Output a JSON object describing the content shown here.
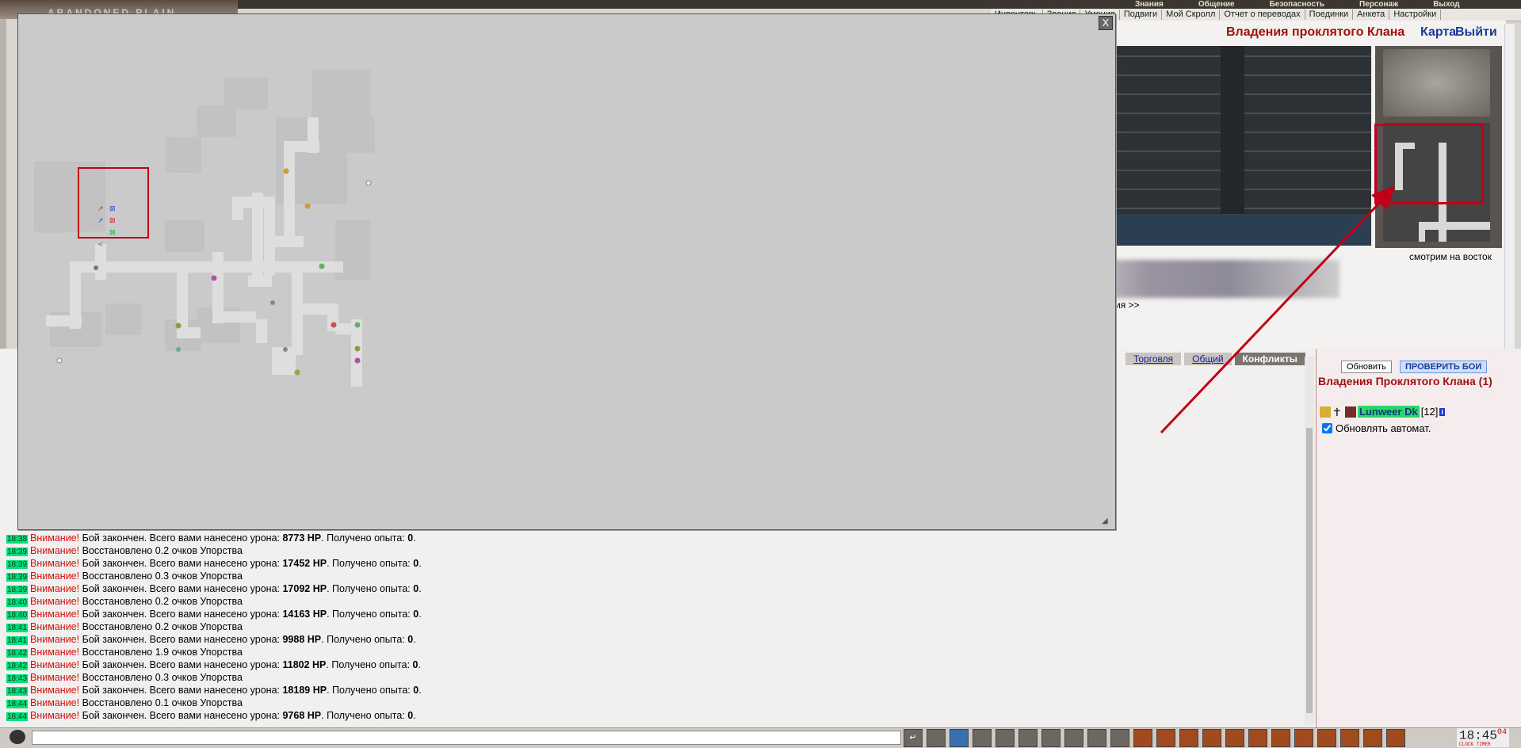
{
  "header": {
    "logo_text": "ABANDONED PLAIN",
    "top_menu": [
      "Знания",
      "Общение",
      "Безопасность",
      "Персонаж",
      "Выход"
    ],
    "sub_menu": [
      "Инвентарь",
      "Звания",
      "Умения",
      "Подвиги",
      "Мой Скролл",
      "Отчет о переводах",
      "Поединки",
      "Анкета",
      "Настройки"
    ]
  },
  "location": {
    "title": "Владения проклятого Клана",
    "map_link": "Карта",
    "exit_link": "Выйти",
    "facing": "смотрим на восток",
    "more": "ия >>"
  },
  "map_window": {
    "close_label": "X"
  },
  "chat": {
    "tabs": [
      "Торговля",
      "Общий",
      "Конфликты"
    ],
    "active_tab": "Конфликты",
    "lines": [
      {
        "time": "18:38",
        "warn": "Внимание!",
        "pre": "Бой закончен. Всего вами нанесено урона: ",
        "dmg": "8773 HP",
        "mid": ". Получено опыта: ",
        "exp": "0",
        "end": "."
      },
      {
        "time": "18:39",
        "warn": "Внимание!",
        "pre": "Восстановлено 0.2 очков Упорства",
        "dmg": "",
        "mid": "",
        "exp": "",
        "end": ""
      },
      {
        "time": "18:39",
        "warn": "Внимание!",
        "pre": "Бой закончен. Всего вами нанесено урона: ",
        "dmg": "17452 HP",
        "mid": ". Получено опыта: ",
        "exp": "0",
        "end": "."
      },
      {
        "time": "18:39",
        "warn": "Внимание!",
        "pre": "Восстановлено 0.3 очков Упорства",
        "dmg": "",
        "mid": "",
        "exp": "",
        "end": ""
      },
      {
        "time": "18:39",
        "warn": "Внимание!",
        "pre": "Бой закончен. Всего вами нанесено урона: ",
        "dmg": "17092 HP",
        "mid": ". Получено опыта: ",
        "exp": "0",
        "end": "."
      },
      {
        "time": "18:40",
        "warn": "Внимание!",
        "pre": "Восстановлено 0.2 очков Упорства",
        "dmg": "",
        "mid": "",
        "exp": "",
        "end": ""
      },
      {
        "time": "18:40",
        "warn": "Внимание!",
        "pre": "Бой закончен. Всего вами нанесено урона: ",
        "dmg": "14163 HP",
        "mid": ". Получено опыта: ",
        "exp": "0",
        "end": "."
      },
      {
        "time": "18:41",
        "warn": "Внимание!",
        "pre": "Восстановлено 0.2 очков Упорства",
        "dmg": "",
        "mid": "",
        "exp": "",
        "end": ""
      },
      {
        "time": "18:41",
        "warn": "Внимание!",
        "pre": "Бой закончен. Всего вами нанесено урона: ",
        "dmg": "9988 HP",
        "mid": ". Получено опыта: ",
        "exp": "0",
        "end": "."
      },
      {
        "time": "18:42",
        "warn": "Внимание!",
        "pre": "Восстановлено 1.9 очков Упорства",
        "dmg": "",
        "mid": "",
        "exp": "",
        "end": ""
      },
      {
        "time": "18:42",
        "warn": "Внимание!",
        "pre": "Бой закончен. Всего вами нанесено урона: ",
        "dmg": "11802 HP",
        "mid": ". Получено опыта: ",
        "exp": "0",
        "end": "."
      },
      {
        "time": "18:43",
        "warn": "Внимание!",
        "pre": "Восстановлено 0.3 очков Упорства",
        "dmg": "",
        "mid": "",
        "exp": "",
        "end": ""
      },
      {
        "time": "18:43",
        "warn": "Внимание!",
        "pre": "Бой закончен. Всего вами нанесено урона: ",
        "dmg": "18189 HP",
        "mid": ". Получено опыта: ",
        "exp": "0",
        "end": "."
      },
      {
        "time": "18:44",
        "warn": "Внимание!",
        "pre": "Восстановлено 0.1 очков Упорства",
        "dmg": "",
        "mid": "",
        "exp": "",
        "end": ""
      },
      {
        "time": "18:44",
        "warn": "Внимание!",
        "pre": "Бой закончен. Всего вами нанесено урона: ",
        "dmg": "9768 HP",
        "mid": ". Получено опыта: ",
        "exp": "0",
        "end": "."
      }
    ]
  },
  "online_panel": {
    "refresh_label": "Обновить",
    "check_label": "ПРОВЕРИТЬ БОИ",
    "title": "Владения Проклятого Клана (1)",
    "player_name": "Lunweer Dk",
    "player_level": "[12]",
    "info_badge": "i",
    "auto_update_label": "Обновлять автомат.",
    "auto_update_checked": true
  },
  "bottom": {
    "clock": "18:45",
    "clock_sec": "04",
    "clock_caption": "CLOCK TIMER"
  },
  "colors": {
    "highlight": "#c00018",
    "timestamp_bg": "#00e07a",
    "warn_text": "#d01010"
  }
}
